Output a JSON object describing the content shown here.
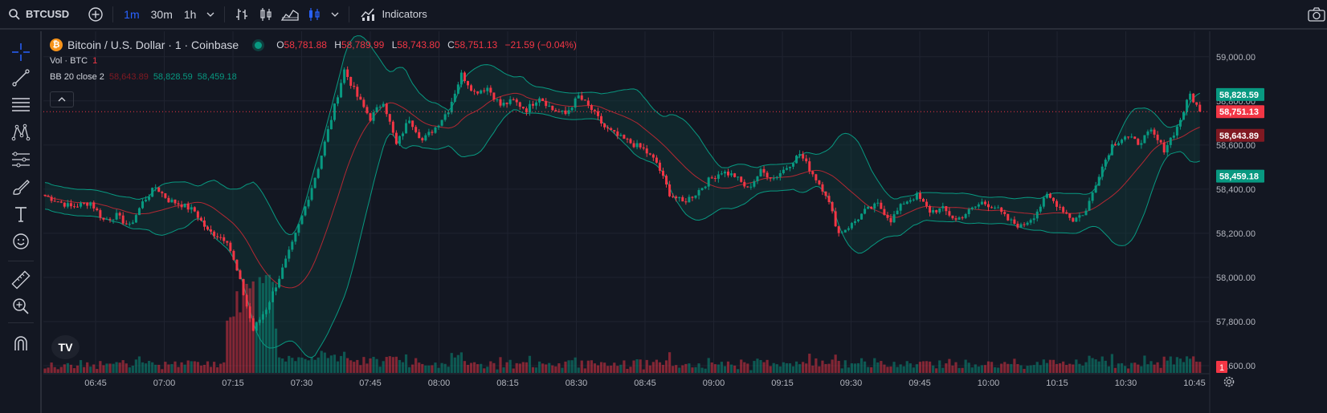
{
  "toolbar": {
    "symbol": "BTCUSD",
    "intervals": [
      {
        "label": "1m",
        "active": true
      },
      {
        "label": "30m",
        "active": false
      },
      {
        "label": "1h",
        "active": false
      }
    ],
    "indicators_label": "Indicators"
  },
  "legend": {
    "title": "Bitcoin / U.S. Dollar · 1 · Coinbase",
    "btc_glyph": "₿",
    "ohlc": [
      {
        "k": "O",
        "v": "58,781.88"
      },
      {
        "k": "H",
        "v": "58,789.99"
      },
      {
        "k": "L",
        "v": "58,743.80"
      },
      {
        "k": "C",
        "v": "58,751.13"
      }
    ],
    "change": "−21.59 (−0.04%)",
    "vol_label": "Vol · BTC",
    "vol_value": "1",
    "bb_label": "BB 20 close 2",
    "bb_basis": "58,643.89",
    "bb_upper": "58,828.59",
    "bb_lower": "58,459.18"
  },
  "logo_text": "TV",
  "chart_data": {
    "type": "candlestick",
    "x_ticks": [
      "06:45",
      "07:00",
      "07:15",
      "07:30",
      "07:45",
      "08:00",
      "08:15",
      "08:30",
      "08:45",
      "09:00",
      "09:15",
      "09:30",
      "09:45",
      "10:00",
      "10:15",
      "10:30",
      "10:45"
    ],
    "y_ticks": [
      "59,000.00",
      "58,800.00",
      "58,600.00",
      "58,400.00",
      "58,200.00",
      "58,000.00",
      "57,800.00",
      "57,600.00"
    ],
    "ylim": [
      57560,
      59090
    ],
    "price_labels": [
      {
        "text": "58,828.59",
        "value": 58828.59,
        "color": "#089981"
      },
      {
        "text": "58,751.13",
        "value": 58751.13,
        "color": "#f23645"
      },
      {
        "text": "58,643.89",
        "value": 58643.89,
        "color": "#801922"
      },
      {
        "text": "58,459.18",
        "value": 58459.18,
        "color": "#089981"
      }
    ],
    "volume_label": "1",
    "current_price": 58751.13,
    "colors": {
      "up": "#089981",
      "down": "#f23645",
      "basis": "#b22833",
      "band": "#089981",
      "band_fill": "#0f3a3a",
      "grid": "#1f2330",
      "axis_text": "#b2b5be"
    },
    "close_path": [
      [
        0,
        58370
      ],
      [
        8,
        58320
      ],
      [
        14,
        58340
      ],
      [
        18,
        58260
      ],
      [
        22,
        58280
      ],
      [
        26,
        58230
      ],
      [
        30,
        58340
      ],
      [
        34,
        58410
      ],
      [
        38,
        58350
      ],
      [
        42,
        58330
      ],
      [
        46,
        58300
      ],
      [
        50,
        58210
      ],
      [
        56,
        58170
      ],
      [
        60,
        57980
      ],
      [
        64,
        57760
      ],
      [
        68,
        57860
      ],
      [
        72,
        58000
      ],
      [
        76,
        58150
      ],
      [
        80,
        58320
      ],
      [
        84,
        58500
      ],
      [
        88,
        58720
      ],
      [
        92,
        58940
      ],
      [
        96,
        58820
      ],
      [
        100,
        58720
      ],
      [
        104,
        58800
      ],
      [
        108,
        58600
      ],
      [
        112,
        58720
      ],
      [
        116,
        58620
      ],
      [
        120,
        58680
      ],
      [
        124,
        58760
      ],
      [
        128,
        58920
      ],
      [
        132,
        58840
      ],
      [
        136,
        58860
      ],
      [
        140,
        58780
      ],
      [
        144,
        58800
      ],
      [
        148,
        58760
      ],
      [
        152,
        58820
      ],
      [
        156,
        58760
      ],
      [
        160,
        58740
      ],
      [
        164,
        58820
      ],
      [
        168,
        58760
      ],
      [
        172,
        58680
      ],
      [
        176,
        58640
      ],
      [
        180,
        58610
      ],
      [
        184,
        58580
      ],
      [
        188,
        58520
      ],
      [
        192,
        58380
      ],
      [
        196,
        58340
      ],
      [
        200,
        58380
      ],
      [
        204,
        58440
      ],
      [
        208,
        58480
      ],
      [
        212,
        58460
      ],
      [
        216,
        58400
      ],
      [
        220,
        58480
      ],
      [
        224,
        58450
      ],
      [
        228,
        58500
      ],
      [
        232,
        58560
      ],
      [
        236,
        58470
      ],
      [
        240,
        58380
      ],
      [
        244,
        58200
      ],
      [
        248,
        58240
      ],
      [
        252,
        58300
      ],
      [
        256,
        58330
      ],
      [
        260,
        58260
      ],
      [
        264,
        58340
      ],
      [
        268,
        58370
      ],
      [
        272,
        58300
      ],
      [
        276,
        58310
      ],
      [
        280,
        58260
      ],
      [
        284,
        58300
      ],
      [
        288,
        58340
      ],
      [
        292,
        58320
      ],
      [
        296,
        58260
      ],
      [
        300,
        58230
      ],
      [
        304,
        58280
      ],
      [
        308,
        58370
      ],
      [
        312,
        58320
      ],
      [
        316,
        58260
      ],
      [
        320,
        58300
      ],
      [
        324,
        58470
      ],
      [
        328,
        58600
      ],
      [
        332,
        58640
      ],
      [
        336,
        58610
      ],
      [
        340,
        58660
      ],
      [
        344,
        58580
      ],
      [
        348,
        58680
      ],
      [
        352,
        58830
      ],
      [
        355,
        58751
      ]
    ]
  }
}
